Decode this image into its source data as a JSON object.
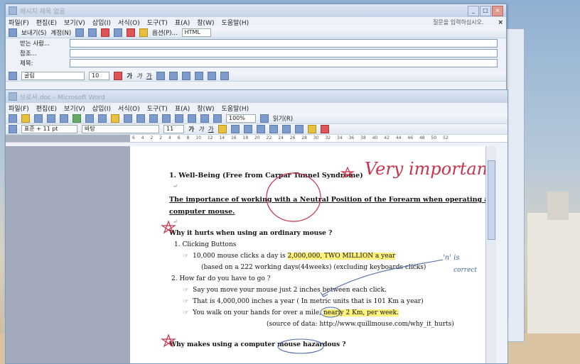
{
  "email_window": {
    "title": "메시지 제목 없음",
    "menu": [
      "파일(F)",
      "편집(E)",
      "보기(V)",
      "삽입(I)",
      "서식(O)",
      "도구(T)",
      "표(A)",
      "창(W)",
      "도움말(H)"
    ],
    "help_prompt": "질문을 입력하십시오.",
    "toolbar": [
      "보내기(S)",
      "계정(N)",
      "옵션(P)...",
      "HTML"
    ],
    "fields": [
      {
        "label": "받는 사람...",
        "value": ""
      },
      {
        "label": "참조...",
        "value": ""
      },
      {
        "label": "제목:",
        "value": ""
      }
    ],
    "format_bar": {
      "font": "굴림",
      "size": "10"
    }
  },
  "word_window": {
    "title": "브로셔.doc - Microsoft Word",
    "menu": [
      "파일(F)",
      "편집(E)",
      "보기(V)",
      "삽입(I)",
      "서식(O)",
      "도구(T)",
      "표(A)",
      "창(W)",
      "도움말(H)"
    ],
    "zoom": "100%",
    "read_button": "읽기(R)",
    "style_box": "표준 + 11 pt",
    "font_box": "바탕",
    "size_box": "11",
    "ruler_numbers": [
      "6",
      "4",
      "2",
      "2",
      "4",
      "6",
      "8",
      "10",
      "12",
      "14",
      "16",
      "18",
      "20",
      "22",
      "24",
      "26",
      "28",
      "30",
      "32",
      "34",
      "36",
      "38",
      "40",
      "42",
      "44",
      "46",
      "48",
      "50",
      "52"
    ]
  },
  "document": {
    "heading": "1.  Well-Being (Free from Carpar Tunnel Syndrome)",
    "subheading_line1": "The importance of working with a Neutral Position of the Forearm when operating a",
    "subheading_line2": "computer mouse.",
    "q1": "Why it hurts when using an ordinary mouse ?",
    "item1": "1.   Clicking Buttons",
    "bullet1a_pre": "10,000 mouse clicks a day is ",
    "bullet1a_hl": "2,000,000, TWO MILLION a year",
    "bullet1b": "(based on a 222 working days(44weeks) (excluding keyboards clicks)",
    "item2": "2. How far do you have to go ?",
    "bullet2a": "Say you move your mouse just 2 inches between each click.",
    "bullet2b": "That is 4,000,000 inches a year ( In metric units that is 101 Km a year)",
    "bullet2c_pre": "You walk on your hands for over a mile, ",
    "bullet2c_hl": "nearly 2 Km, per week.",
    "source": "(source of data: http://www.quillmouse.com/why_it_hurts)",
    "q2": "Why makes using a computer mouse hazardous ?"
  },
  "handwriting": {
    "very_important": "Very  important",
    "n_is": "'n' is",
    "correct": "correct"
  }
}
